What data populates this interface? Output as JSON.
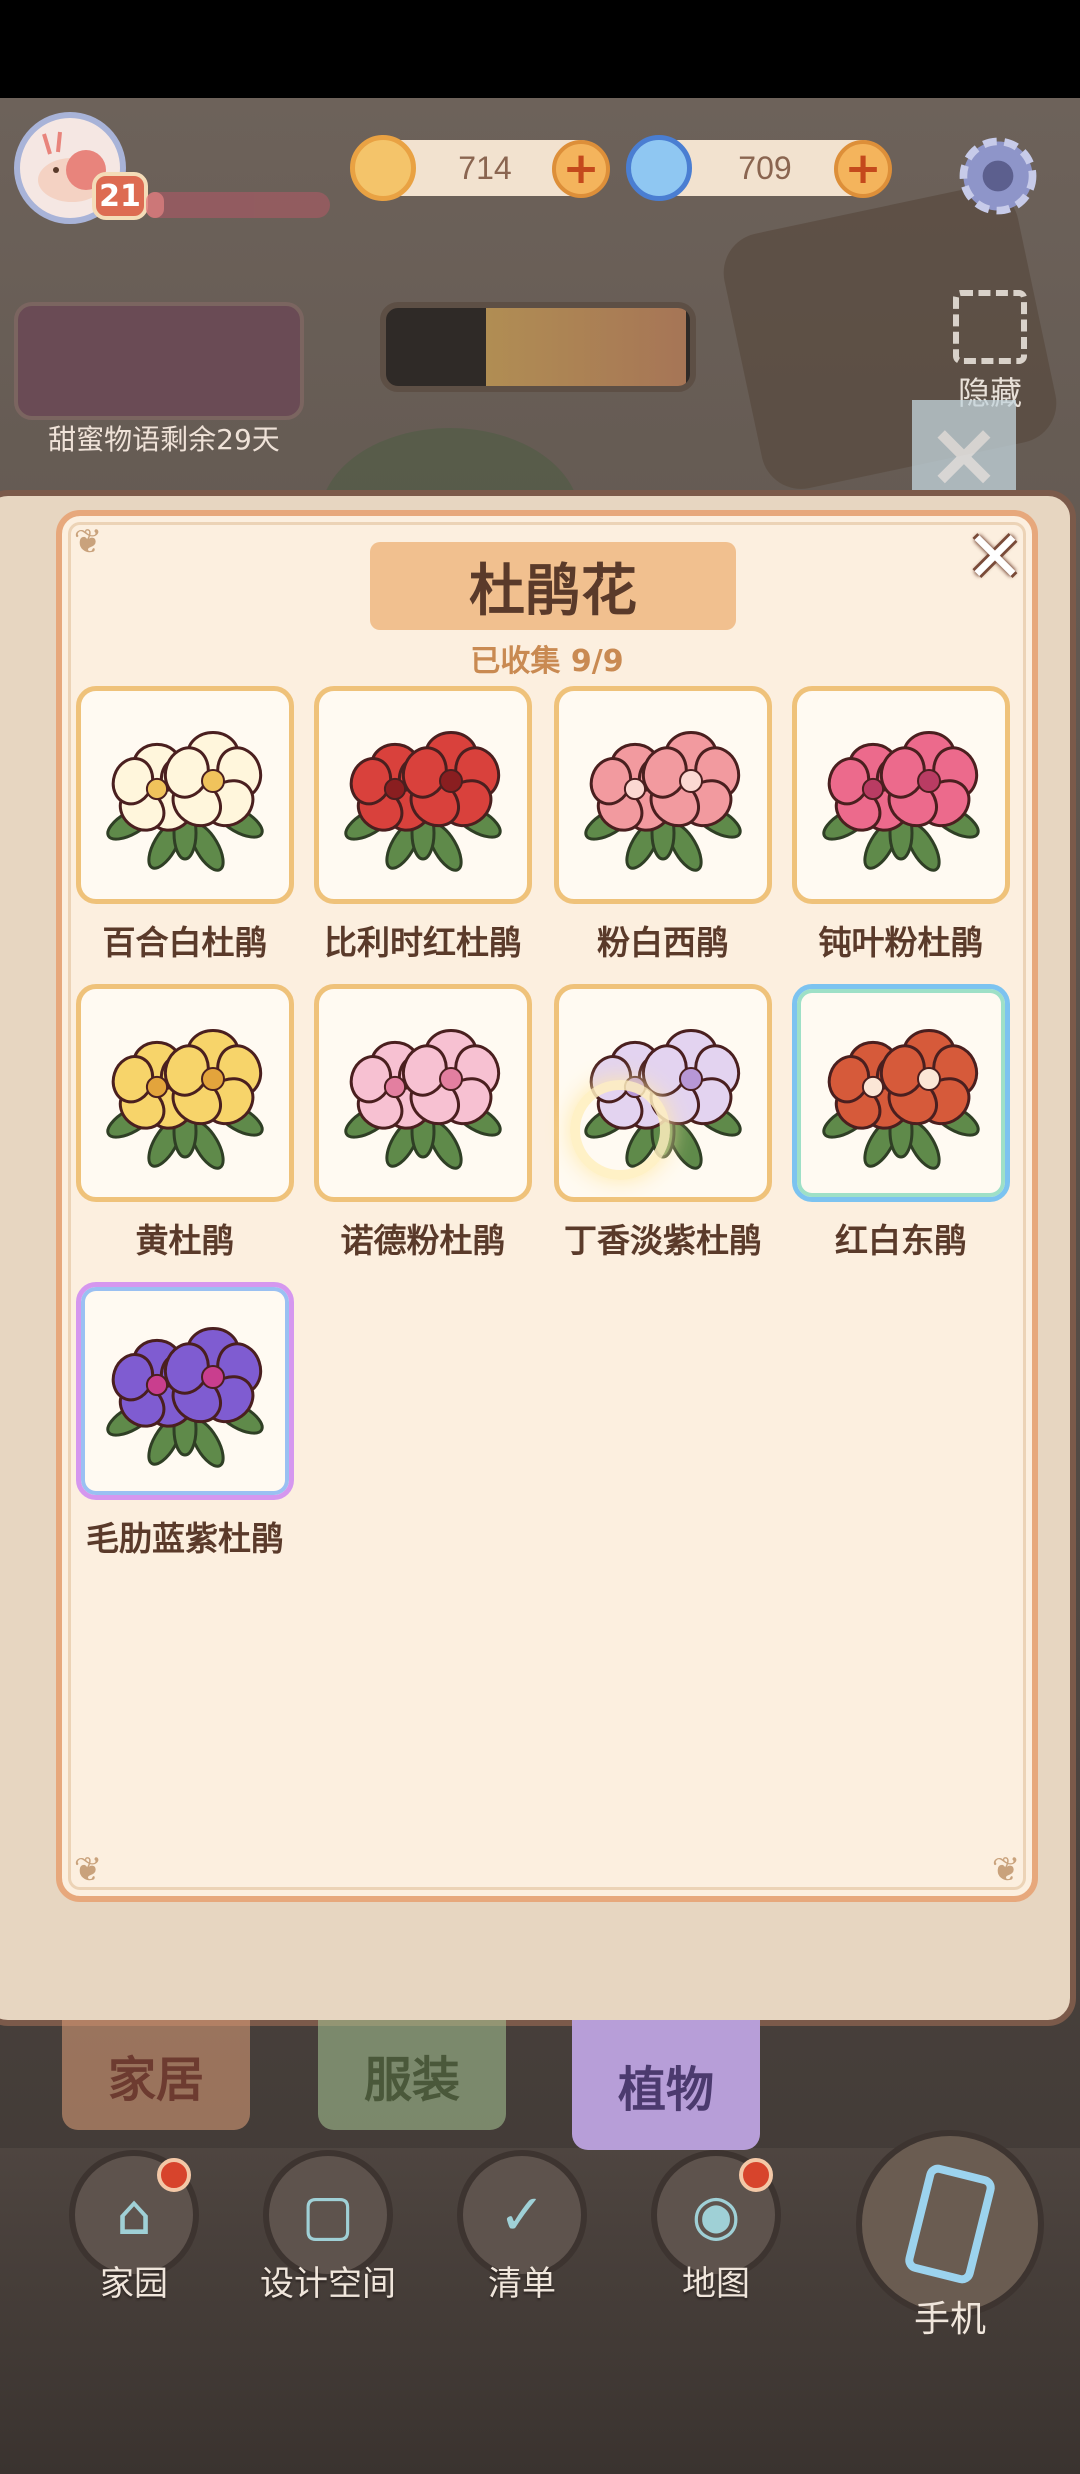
{
  "hud": {
    "level": "21",
    "coins": "714",
    "gems": "709",
    "xp_fraction": 0.1,
    "event_text": "甜蜜物语剩余29天",
    "hide_label": "隐藏"
  },
  "dialog": {
    "title": "杜鹃花",
    "collected": "已收集  9/9",
    "items": [
      {
        "name": "百合白杜鹃",
        "frame": "gold",
        "petal": "#fff6dc",
        "center": "#f0c35c"
      },
      {
        "name": "比利时红杜鹃",
        "frame": "gold",
        "petal": "#d9413c",
        "center": "#8a1e20"
      },
      {
        "name": "粉白西鹃",
        "frame": "gold",
        "petal": "#f29a9f",
        "center": "#fbd8d2"
      },
      {
        "name": "钝叶粉杜鹃",
        "frame": "gold",
        "petal": "#ec6a8c",
        "center": "#b93c63"
      },
      {
        "name": "黄杜鹃",
        "frame": "gold",
        "petal": "#f7d46a",
        "center": "#e3a43c"
      },
      {
        "name": "诺德粉杜鹃",
        "frame": "gold",
        "petal": "#f7c1d2",
        "center": "#e37fa0"
      },
      {
        "name": "丁香淡紫杜鹃",
        "frame": "gold",
        "petal": "#e3d3f0",
        "center": "#b797d6"
      },
      {
        "name": "红白东鹃",
        "frame": "blue",
        "petal": "#d65a3a",
        "center": "#fbe6d6"
      },
      {
        "name": "毛肋蓝紫杜鹃",
        "frame": "purple",
        "petal": "#7f5cd1",
        "center": "#c93e8e"
      }
    ]
  },
  "tabs": [
    {
      "label": "家居",
      "color": "#e0a07a",
      "text": "#8f3a2a"
    },
    {
      "label": "服装",
      "color": "#a8c796",
      "text": "#4f6f3c"
    },
    {
      "label": "植物",
      "color": "#b79ed8",
      "text": "#4b3a6e"
    }
  ],
  "nav": [
    {
      "label": "家园",
      "icon": "⌂",
      "badge": true
    },
    {
      "label": "设计空间",
      "icon": "▢",
      "badge": false
    },
    {
      "label": "清单",
      "icon": "✓",
      "badge": false
    },
    {
      "label": "地图",
      "icon": "◉",
      "badge": true
    }
  ],
  "phone_label": "手机"
}
